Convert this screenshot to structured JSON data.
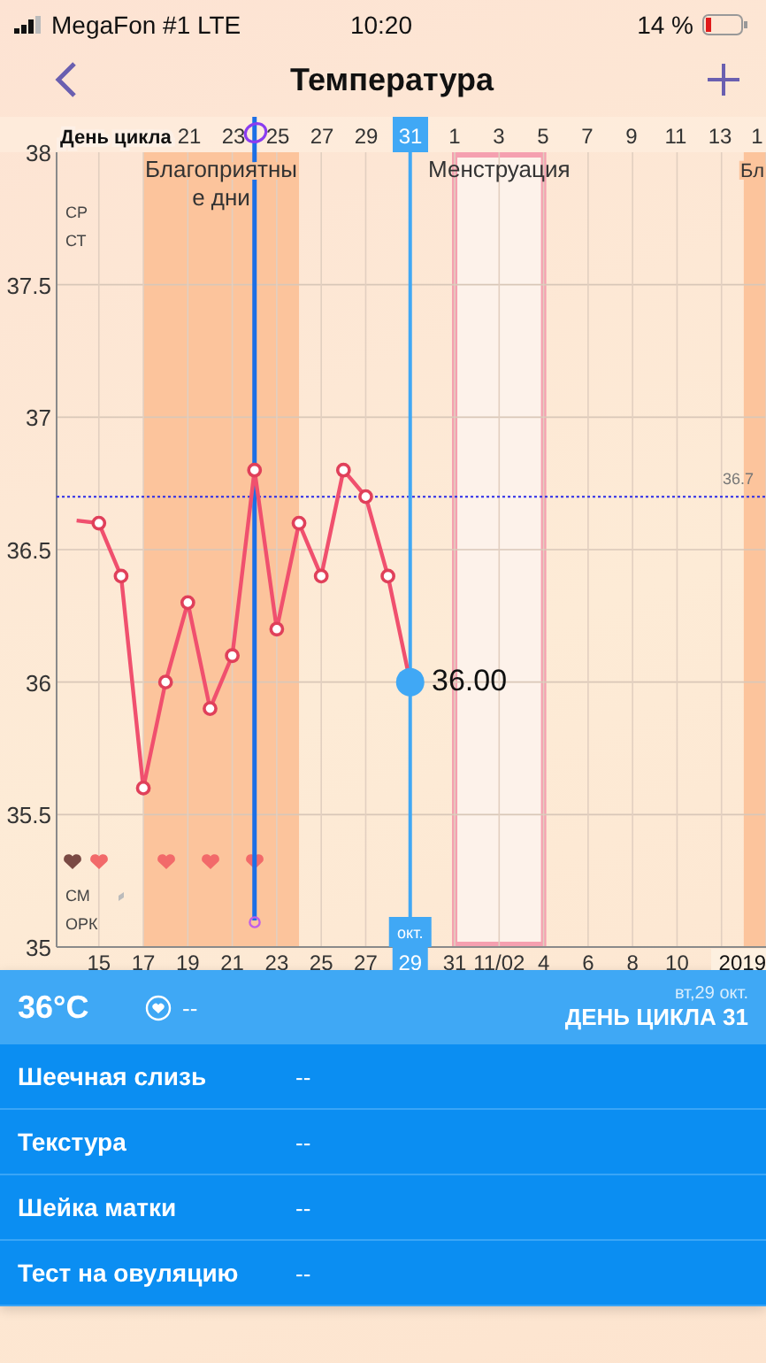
{
  "status_bar": {
    "carrier": "MegaFon #1 LTE",
    "time": "10:20",
    "battery": "14 %"
  },
  "nav": {
    "title": "Температура"
  },
  "chart": {
    "cycle_label": "День цикла",
    "cycle_days": [
      {
        "label": "21",
        "selected": false
      },
      {
        "label": "23",
        "selected": false
      },
      {
        "label": "25",
        "selected": false
      },
      {
        "label": "27",
        "selected": false
      },
      {
        "label": "29",
        "selected": false
      },
      {
        "label": "31",
        "selected": true
      },
      {
        "label": "1",
        "selected": false
      },
      {
        "label": "3",
        "selected": false
      },
      {
        "label": "5",
        "selected": false
      },
      {
        "label": "7",
        "selected": false
      },
      {
        "label": "9",
        "selected": false
      },
      {
        "label": "11",
        "selected": false
      },
      {
        "label": "13",
        "selected": false
      },
      {
        "label": "1",
        "selected": false
      }
    ],
    "date_ticks": [
      {
        "selected": false
      },
      {
        "selected": false
      },
      {
        "selected": false
      },
      {
        "selected": false
      },
      {
        "selected": false
      },
      {
        "selected": false
      },
      {
        "selected": false
      },
      {
        "selected": true
      },
      {
        "selected": false
      },
      {
        "selected": false
      }
    ],
    "later_dates": [
      "4",
      "6",
      "8",
      "10"
    ],
    "selected_month": "окт.",
    "year": "2019",
    "top_rows": [
      "СР",
      "СТ"
    ],
    "bottom_rows": [
      "СМ",
      "ОРК"
    ],
    "selected_value": "36.00",
    "chart_data": {
      "type": "line",
      "grid": true,
      "x": [
        14,
        15,
        16,
        17,
        18,
        19,
        20,
        21,
        22,
        23,
        24,
        25,
        26,
        27,
        28,
        29
      ],
      "xlim": [
        13.1,
        45
      ],
      "ylim": [
        35,
        38
      ],
      "xticks": [
        15,
        17,
        19,
        21,
        23,
        25,
        27,
        29,
        31,
        {
          "value": 33,
          "label": "11/02"
        }
      ],
      "yticks": [
        35,
        35.5,
        36,
        36.5,
        37,
        37.5,
        38
      ],
      "bands": [
        {
          "axis": "x",
          "from": 17,
          "to": 24,
          "label": "Благоприятны\nе дни"
        },
        {
          "axis": "x",
          "from": 31,
          "to": 35,
          "label": "Менструация"
        },
        {
          "axis": "x",
          "from": 44,
          "to": 45,
          "label": "Бл"
        }
      ],
      "ref_lines": [
        {
          "axis": "y",
          "value": 36.7,
          "label": "36.7"
        },
        {
          "axis": "x",
          "value": 22
        },
        {
          "axis": "x",
          "value": 29
        }
      ],
      "series": [
        {
          "color": "#f0506e",
          "marker": "o",
          "values": [
            36.61,
            36.6,
            36.4,
            35.6,
            36.0,
            36.3,
            35.9,
            36.1,
            36.8,
            36.2,
            36.6,
            36.4,
            36.8,
            36.7,
            36.4,
            36.0
          ]
        }
      ]
    }
  },
  "day_panel": {
    "temperature": "36°C",
    "sex": "--",
    "date": "вт,29 окт.",
    "cycle_day": "ДЕНЬ ЦИКЛА 31"
  },
  "fields": [
    {
      "label": "Шеечная слизь",
      "value": "--"
    },
    {
      "label": "Текстура",
      "value": "--"
    },
    {
      "label": "Шейка матки",
      "value": "--"
    },
    {
      "label": "Тест на овуляцию",
      "value": "--"
    }
  ]
}
